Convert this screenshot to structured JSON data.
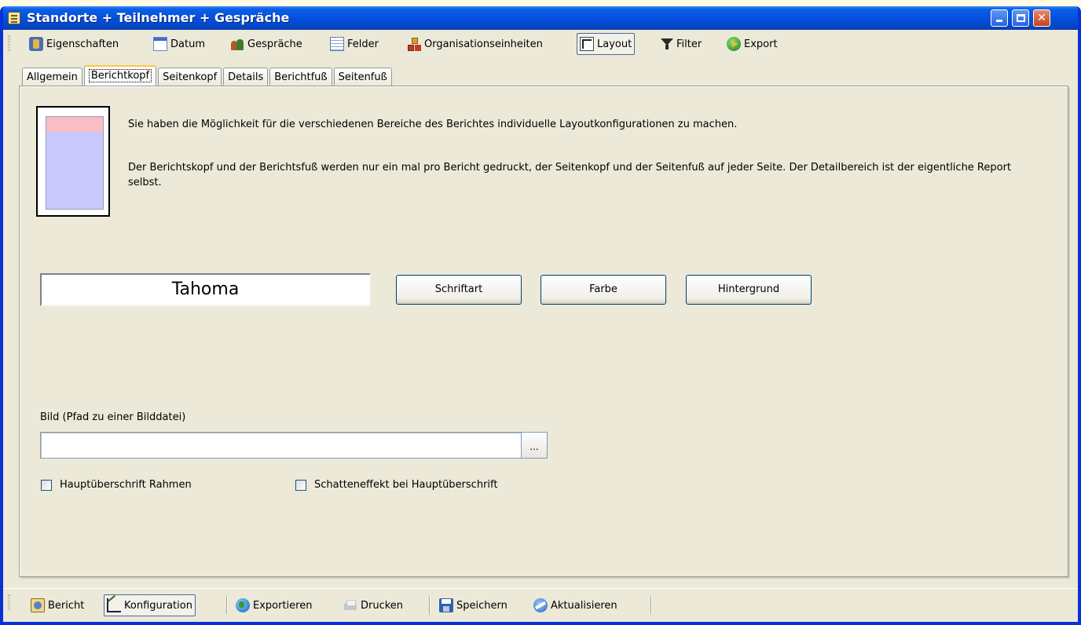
{
  "window": {
    "title": "Standorte + Teilnehmer + Gespräche"
  },
  "toolbar": {
    "items": [
      {
        "label": "Eigenschaften",
        "icon": "properties-icon"
      },
      {
        "label": "Datum",
        "icon": "calendar-icon"
      },
      {
        "label": "Gespräche",
        "icon": "people-icon"
      },
      {
        "label": "Felder",
        "icon": "fields-icon"
      },
      {
        "label": "Organisationseinheiten",
        "icon": "org-units-icon"
      },
      {
        "label": "Layout",
        "icon": "layout-icon",
        "active": true
      },
      {
        "label": "Filter",
        "icon": "filter-icon"
      },
      {
        "label": "Export",
        "icon": "export-icon"
      }
    ]
  },
  "tabs": [
    {
      "label": "Allgemein"
    },
    {
      "label": "Berichtkopf",
      "active": true
    },
    {
      "label": "Seitenkopf"
    },
    {
      "label": "Details"
    },
    {
      "label": "Berichtfuß"
    },
    {
      "label": "Seitenfuß"
    }
  ],
  "content": {
    "info_line1": "Sie haben die Möglichkeit für die verschiedenen Bereiche des Berichtes individuelle Layoutkonfigurationen zu machen.",
    "info_line2": "Der Berichtskopf und der Berichtsfuß werden nur ein mal pro Bericht gedruckt, der Seitenkopf und der Seitenfuß  auf jeder Seite. Der Detailbereich ist der eigentliche Report selbst.",
    "font_preview": "Tahoma",
    "buttons": {
      "font": "Schriftart",
      "color": "Farbe",
      "background": "Hintergrund"
    },
    "image_label": "Bild (Pfad zu einer Bilddatei)",
    "image_path_value": "",
    "browse_label": "...",
    "checkbox_frame": {
      "label": "Hauptüberschrift Rahmen",
      "checked": false
    },
    "checkbox_shadow": {
      "label": "Schatteneffekt bei Hauptüberschrift",
      "checked": false
    }
  },
  "statusbar": {
    "items": [
      {
        "label": "Bericht",
        "icon": "report-icon"
      },
      {
        "label": "Konfiguration",
        "icon": "configuration-icon",
        "active": true
      },
      {
        "label": "Exportieren",
        "icon": "globe-icon"
      },
      {
        "label": "Drucken",
        "icon": "printer-icon",
        "disabled": true
      },
      {
        "label": "Speichern",
        "icon": "save-icon"
      },
      {
        "label": "Aktualisieren",
        "icon": "refresh-icon"
      }
    ]
  },
  "colors": {
    "titlebar": "#0550dd",
    "window_bg": "#ece9d8",
    "page_header_preview": "#fabdc4",
    "page_body_preview": "#c8c8fb"
  }
}
